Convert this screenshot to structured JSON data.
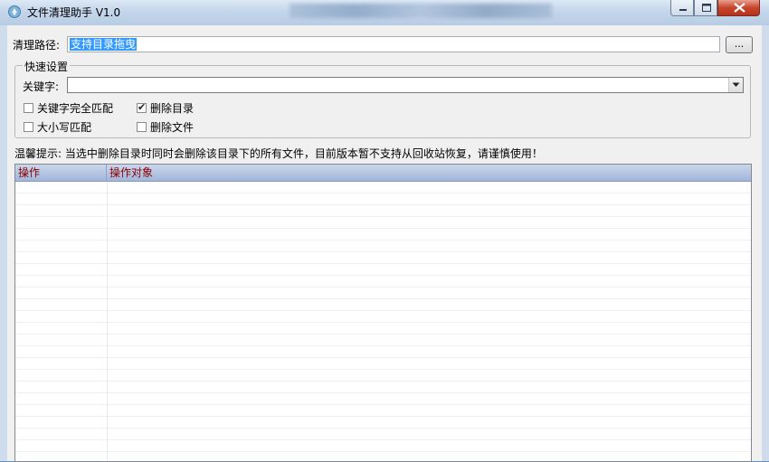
{
  "window": {
    "title": "文件清理助手 V1.0",
    "icon": "recycle-app-icon",
    "buttons": {
      "minimize": "minimize-icon",
      "maximize": "maximize-icon",
      "close": "close-icon"
    }
  },
  "path": {
    "label": "清理路径:",
    "value": "支持目录拖曳",
    "browse_label": "..."
  },
  "quick_settings": {
    "title": "快速设置",
    "keyword_label": "关键字:",
    "keyword_value": "",
    "options": [
      {
        "label": "关键字完全匹配",
        "checked": false
      },
      {
        "label": "大小写匹配",
        "checked": false
      },
      {
        "label": "删除目录",
        "checked": true
      },
      {
        "label": "删除文件",
        "checked": false
      }
    ]
  },
  "warning": "温馨提示: 当选中删除目录时同时会删除该目录下的所有文件，目前版本暂不支持从回收站恢复，请谨慎使用！",
  "table": {
    "columns": [
      "操作",
      "操作对象"
    ],
    "rows": []
  },
  "colors": {
    "selection": "#3399ff",
    "header_text": "#8b0000",
    "header_bg": "#a3b6da"
  }
}
